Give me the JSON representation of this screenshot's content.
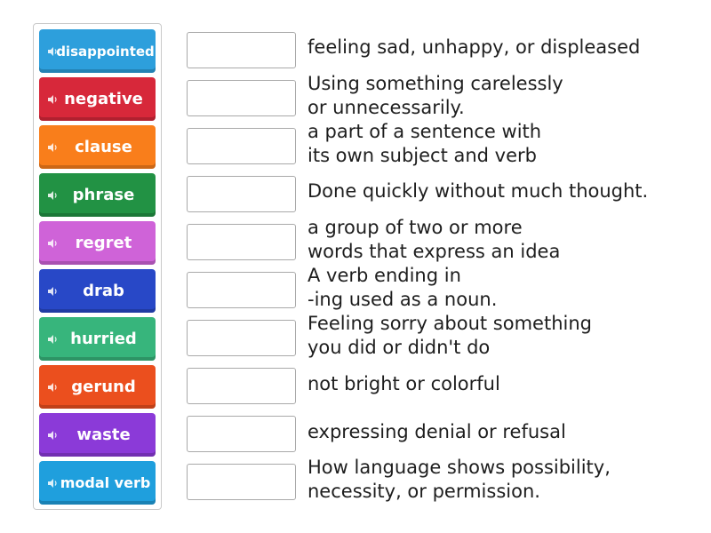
{
  "tiles": [
    {
      "label": "disappointed",
      "color": "#2d9fdc",
      "icon": "speaker-icon"
    },
    {
      "label": "negative",
      "color": "#d7283a",
      "icon": "speaker-icon"
    },
    {
      "label": "clause",
      "color": "#f97e1b",
      "icon": "speaker-icon"
    },
    {
      "label": "phrase",
      "color": "#229244",
      "icon": "speaker-icon"
    },
    {
      "label": "regret",
      "color": "#cf63d8",
      "icon": "speaker-icon"
    },
    {
      "label": "drab",
      "color": "#2848c7",
      "icon": "speaker-icon"
    },
    {
      "label": "hurried",
      "color": "#37b57c",
      "icon": "speaker-icon"
    },
    {
      "label": "gerund",
      "color": "#eb4f1e",
      "icon": "speaker-icon"
    },
    {
      "label": "waste",
      "color": "#8b3ad8",
      "icon": "speaker-icon"
    },
    {
      "label": "modal verb",
      "color": "#1f9fdd",
      "icon": "speaker-icon"
    }
  ],
  "definitions": [
    {
      "line1": "feeling sad, unhappy, or displeased",
      "line2": ""
    },
    {
      "line1": "Using something carelessly",
      "line2": "or unnecessarily."
    },
    {
      "line1": "a part of a sentence with",
      "line2": "its own subject and verb"
    },
    {
      "line1": "Done quickly without much thought.",
      "line2": ""
    },
    {
      "line1": "a group of two or more",
      "line2": "words that express an idea"
    },
    {
      "line1": "A verb ending in",
      "line2": "-ing used as a noun."
    },
    {
      "line1": "Feeling sorry about something",
      "line2": "you did or didn't do"
    },
    {
      "line1": "not bright or colorful",
      "line2": ""
    },
    {
      "line1": "expressing denial or refusal",
      "line2": ""
    },
    {
      "line1": "How language shows possibility,",
      "line2": "necessity, or permission."
    }
  ]
}
